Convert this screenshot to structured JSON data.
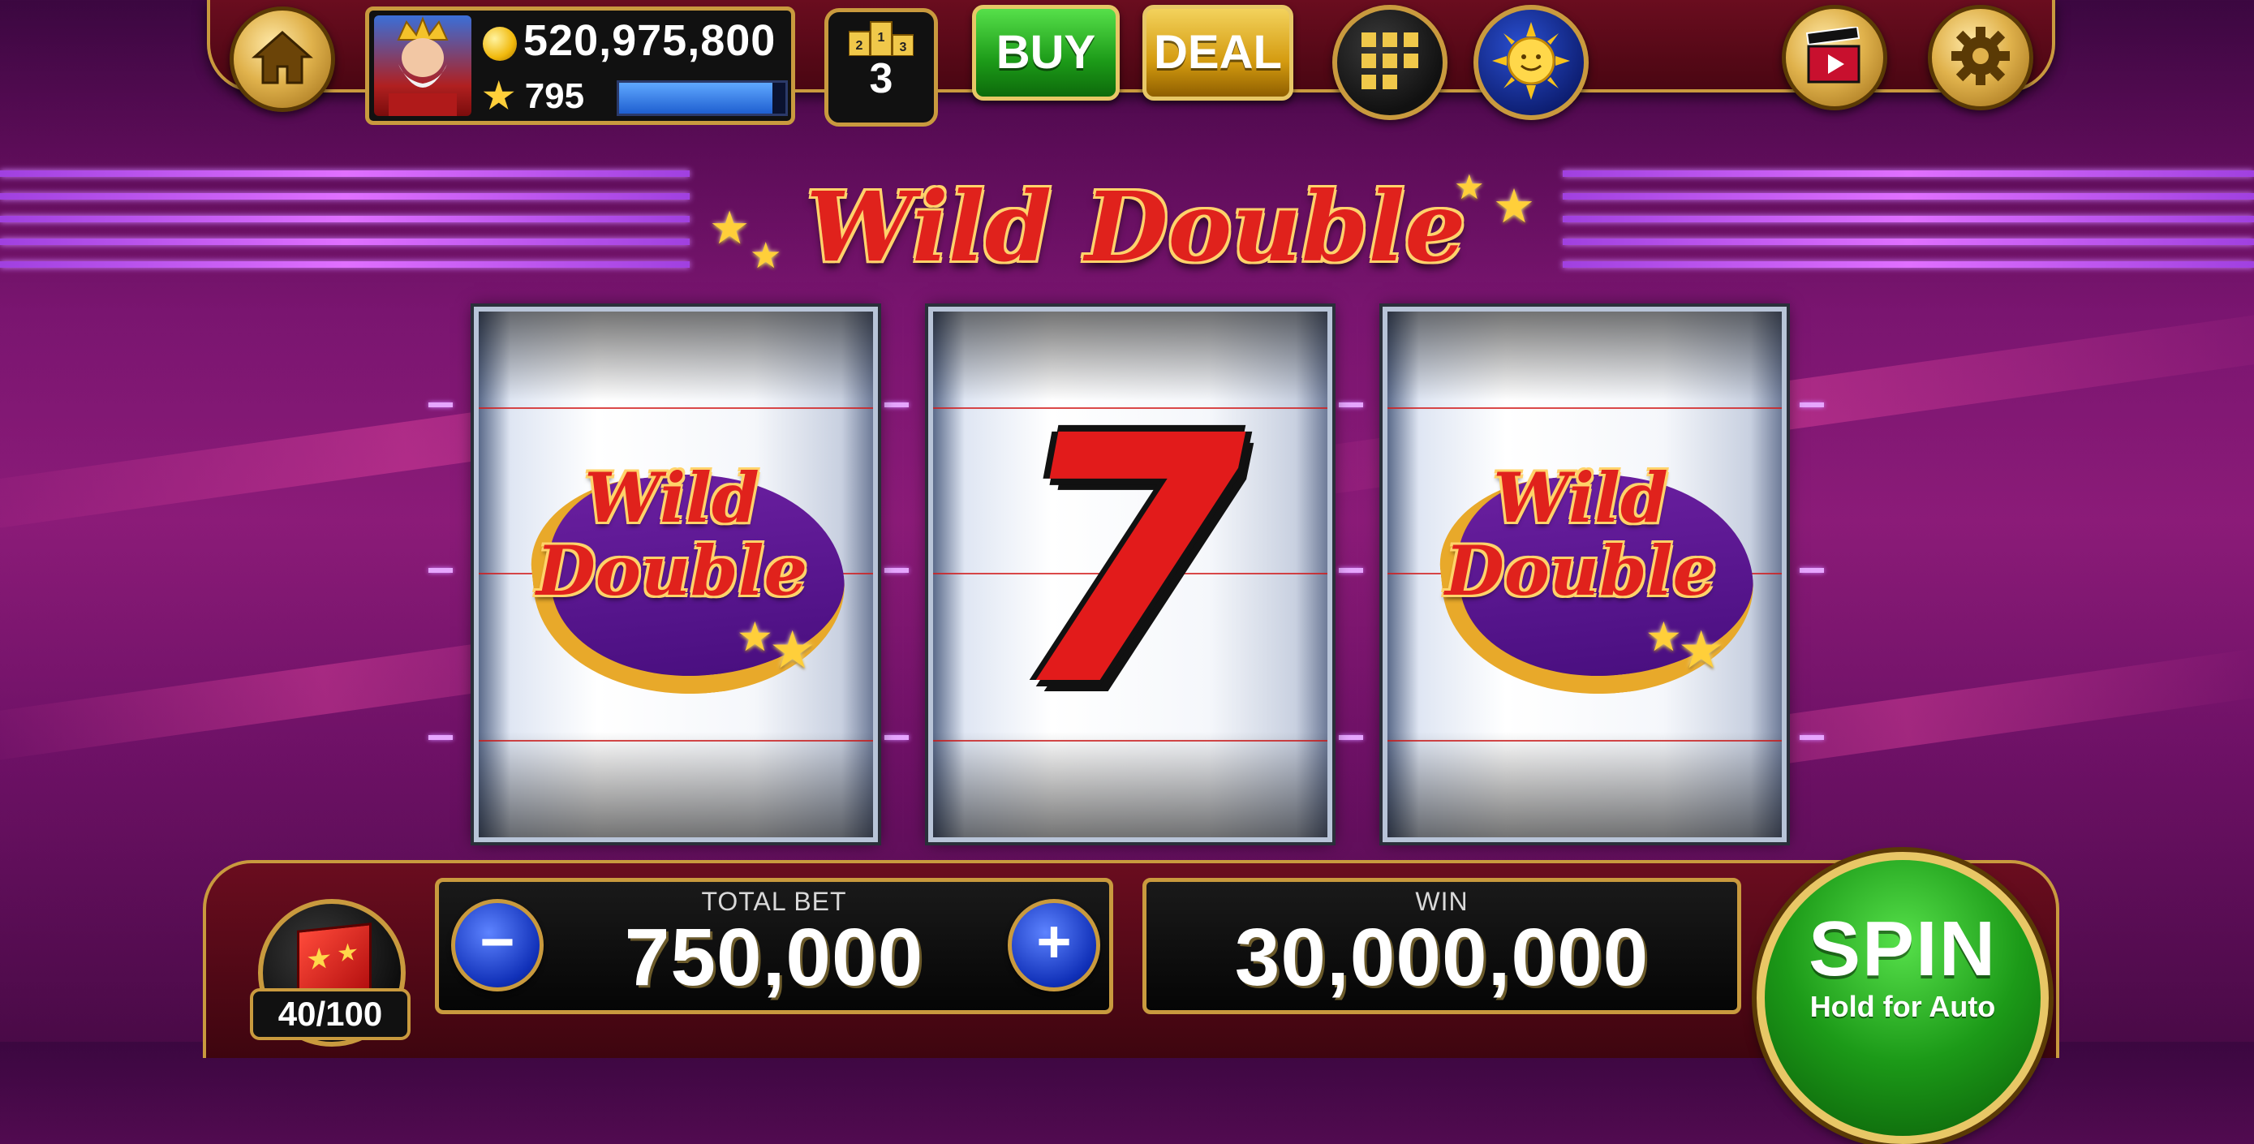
{
  "top_bar": {
    "coins": "520,975,800",
    "level": "795",
    "xp_progress_percent": 92,
    "rank": "3",
    "rank_podium_labels": [
      "2",
      "1",
      "3"
    ],
    "buy_label": "BUY",
    "deal_label": "DEAL"
  },
  "game": {
    "title": "Wild Double",
    "reels": [
      {
        "symbol": "Wild Double",
        "symbol_lines": [
          "Wild",
          "Double"
        ]
      },
      {
        "symbol": "7"
      },
      {
        "symbol": "Wild Double",
        "symbol_lines": [
          "Wild",
          "Double"
        ]
      }
    ]
  },
  "bottom_bar": {
    "gift_progress": "40/100",
    "total_bet_label": "TOTAL BET",
    "total_bet_value": "750,000",
    "minus_label": "−",
    "plus_label": "+",
    "win_label": "WIN",
    "win_value": "30,000,000",
    "spin_label": "SPIN",
    "spin_sublabel": "Hold for Auto"
  },
  "icons": {
    "home": "home-icon",
    "coin": "coin-icon",
    "star": "star-icon",
    "leaderboard": "podium-icon",
    "games_grid": "grid-icon",
    "sun_logo": "sun-icon",
    "video": "clapperboard-icon",
    "settings": "gear-icon",
    "gift": "gift-box-icon"
  },
  "colors": {
    "gold_trim": "#c99a3e",
    "buy_green": "#1c9a18",
    "deal_gold": "#d49b10",
    "title_red": "#e0221c",
    "background_purple": "#7a1570"
  }
}
